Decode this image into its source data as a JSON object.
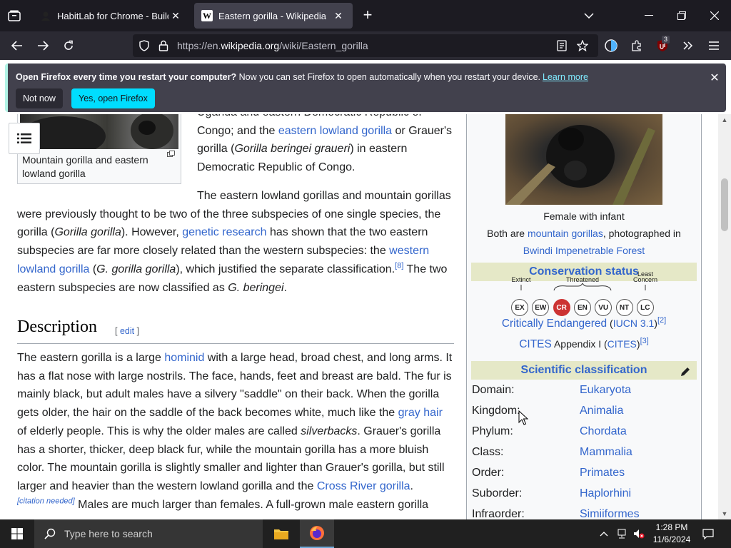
{
  "browser": {
    "tabs": [
      {
        "title": "HabitLab for Chrome - Build be",
        "close": "✕"
      },
      {
        "title": "Eastern gorilla - Wikipedia",
        "close": "✕",
        "favicon": "W"
      }
    ],
    "new_tab": "+",
    "url": {
      "prefix": "https://en.",
      "host": "wikipedia.org",
      "path": "/wiki/Eastern_gorilla"
    },
    "extension_badge": "3"
  },
  "notification": {
    "bold": "Open Firefox every time you restart your computer?",
    "text": " Now you can set Firefox to open automatically when you restart your device.",
    "link": "Learn more",
    "not_now": "Not now",
    "yes": "Yes, open Firefox",
    "close": "✕"
  },
  "article": {
    "thumb_caption": "Mountain gorilla and eastern lowland gorilla",
    "p1": {
      "line0": "Uganda and eastern Democratic Republic of",
      "line1a": "Congo; and the ",
      "line1link": "eastern lowland gorilla",
      "line1b": " or Grauer's",
      "line2a": "gorilla (",
      "line2i": "Gorilla beringei graueri",
      "line2b": ") in eastern",
      "line3": "Democratic Republic of Congo."
    },
    "p2": {
      "l1": "The eastern lowland gorillas and mountain gorillas",
      "l2": "were previously thought to be two of the three subspecies of one single species, the",
      "l3a": "gorilla (",
      "l3i": "Gorilla gorilla",
      "l3b": "). However, ",
      "l3link": "genetic research",
      "l3c": " has shown that the two eastern",
      "l4a": "subspecies are far more closely related than the western subspecies: the ",
      "l4link": "western",
      "l5link": "lowland gorilla",
      "l5a": " (",
      "l5i": "G. gorilla gorilla",
      "l5b": "), which justified the separate classification.",
      "l5sup": "[8]",
      "l5c": " The two",
      "l6a": "eastern subspecies are now classified as ",
      "l6i": "G. beringei",
      "l6b": "."
    },
    "description_heading": "Description",
    "edit_open": "[ ",
    "edit": "edit",
    "edit_close": " ]",
    "p3": {
      "l1a": "The eastern gorilla is a large ",
      "l1link": "hominid",
      "l1b": " with a large head, broad chest, and long arms. It",
      "l2": "has a flat nose with large nostrils. The face, hands, feet and breast are bald. The fur is",
      "l3": "mainly black, but adult males have a silvery \"saddle\" on their back. When the gorilla",
      "l4a": "gets older, the hair on the saddle of the back becomes white, much like the ",
      "l4link": "gray hair",
      "l5a": "of elderly people. This is why the older males are called ",
      "l5i": "silverbacks",
      "l5b": ". Grauer's gorilla",
      "l6": "has a shorter, thicker, deep black fur, while the mountain gorilla has a more bluish",
      "l7": "color. The mountain gorilla is slightly smaller and lighter than Grauer's gorilla, but still",
      "l8a": "larger and heavier than the western lowland gorilla and the ",
      "l8link": "Cross River gorilla",
      "l8b": ".",
      "l9sup": "[citation needed]",
      "l9": " Males are much larger than females. A full-grown male eastern gorilla"
    }
  },
  "infobox": {
    "caption1": "Female with infant",
    "caption2a": "Both are ",
    "caption2link": "mountain gorillas",
    "caption2b": ", photographed in",
    "caption3link": "Bwindi Impenetrable Forest",
    "conservation_title": "Conservation status",
    "iucn_top": {
      "extinct": "Extinct",
      "threatened": "Threatened",
      "least": "Least",
      "concern": "Concern"
    },
    "iucn_codes": [
      "EX",
      "EW",
      "CR",
      "EN",
      "VU",
      "NT",
      "LC"
    ],
    "status_link": "Critically Endangered",
    "status_paren_open": " (",
    "status_src": "IUCN 3.1",
    "status_paren_close": ")",
    "status_sup": "[2]",
    "cites_link": "CITES",
    "cites_text": " Appendix I (",
    "cites_src": "CITES",
    "cites_close": ")",
    "cites_sup": "[3]",
    "sci_title": "Scientific classification",
    "taxonomy": [
      {
        "rank": "Domain:",
        "value": "Eukaryota"
      },
      {
        "rank": "Kingdom:",
        "value": "Animalia"
      },
      {
        "rank": "Phylum:",
        "value": "Chordata"
      },
      {
        "rank": "Class:",
        "value": "Mammalia"
      },
      {
        "rank": "Order:",
        "value": "Primates"
      },
      {
        "rank": "Suborder:",
        "value": "Haplorhini"
      },
      {
        "rank": "Infraorder:",
        "value": "Simiiformes"
      }
    ]
  },
  "taskbar": {
    "search_placeholder": "Type here to search",
    "time": "1:28 PM",
    "date": "11/6/2024"
  },
  "colors": {
    "link": "#3366cc",
    "accent_cyan": "#00ddff",
    "cr_red": "#cc3333",
    "band": "#e5e8c7"
  }
}
